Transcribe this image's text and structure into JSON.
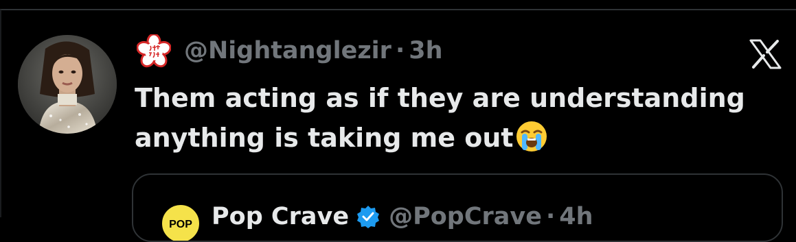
{
  "tweet": {
    "handle": "@Nightanglezir",
    "separator": "·",
    "time": "3h",
    "text": "Them acting as if they are understanding anything is taking me out",
    "emoji": "loudly-crying-face-emoji"
  },
  "quoted_tweet": {
    "name": "Pop Crave",
    "handle": "@PopCrave",
    "separator": "·",
    "time": "4h",
    "avatar_text": "POP"
  },
  "colors": {
    "background": "#000000",
    "primary_text": "#e7e9ea",
    "secondary_text": "#71767b",
    "border": "#2f3336",
    "verified": "#1d9bf0",
    "badge_red": "#d62828"
  }
}
